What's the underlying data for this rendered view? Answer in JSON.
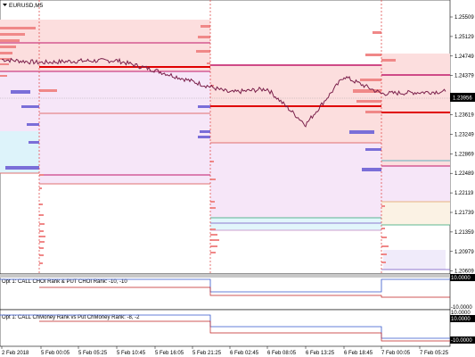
{
  "symbol_title": "EURUSD,M5",
  "current_price": "1.23956",
  "price_axis": [
    "1.25509",
    "1.25129",
    "1.24749",
    "1.24379",
    "1.23999",
    "1.23619",
    "1.23249",
    "1.22869",
    "1.22489",
    "1.22119",
    "1.21739",
    "1.21359",
    "1.20979",
    "1.20609"
  ],
  "time_axis": [
    "2 Feb 2018",
    "5 Feb 00:05",
    "5 Feb 05:25",
    "5 Feb 10:45",
    "5 Feb 16:05",
    "5 Feb 21:25",
    "6 Feb 02:45",
    "6 Feb 08:05",
    "6 Feb 13:25",
    "6 Feb 18:45",
    "7 Feb 00:05",
    "7 Feb 05:25"
  ],
  "indicator1": {
    "label": "Opt 1: CALL CHOI Rank & PUT CHOI Rank: -10, -10",
    "axis_top": "10.0000",
    "axis_bottom": "-10.0000"
  },
  "indicator2": {
    "label": "Opt 1: CALL ChMoney Rank vs Put ChMoney Rank: -8, -2",
    "axis_top": "10.0000",
    "axis_mid": "10.0000",
    "axis_bottom": "-10.0000"
  },
  "colors": {
    "bg": "#ffffff",
    "candles": "#7a1f4a",
    "red_level": "#e00000",
    "magenta_level": "#c0186a",
    "bid_label": "#000000",
    "pink_zone": "#fcdede",
    "lavender_zone": "#f6e6f8",
    "cyan_zone": "#ddf3fa",
    "volume_profile": "#f08888",
    "purple_bar": "#7a6ed8",
    "session_sep": "#e05050",
    "blue_line": "#3355cc"
  },
  "chart_data": {
    "type": "line",
    "title": "EURUSD,M5",
    "xlabel": "",
    "ylabel": "",
    "x": [
      "2 Feb 2018",
      "5 Feb 00:05",
      "5 Feb 05:25",
      "5 Feb 10:45",
      "5 Feb 16:05",
      "5 Feb 21:25",
      "6 Feb 02:45",
      "6 Feb 08:05",
      "6 Feb 13:25",
      "6 Feb 18:45",
      "7 Feb 00:05",
      "7 Feb 05:25"
    ],
    "series": [
      {
        "values": [
          1.2455,
          1.2449,
          1.2452,
          1.2453,
          1.2434,
          1.2402,
          1.2391,
          1.2398,
          1.2329,
          1.2422,
          1.2389,
          1.2393
        ]
      }
    ],
    "ylim": [
      1.204,
      1.257
    ]
  }
}
